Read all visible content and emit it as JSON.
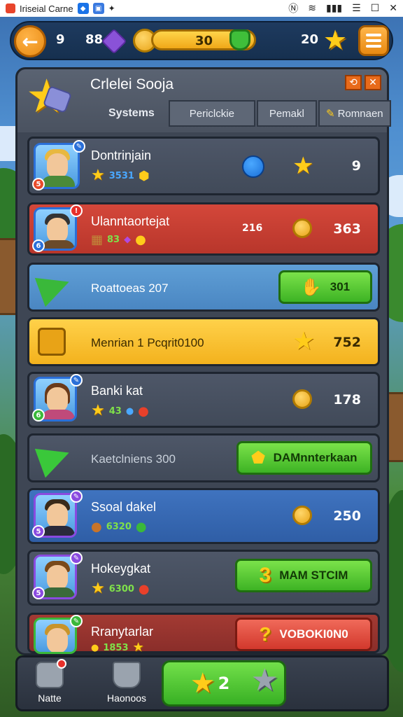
{
  "status_bar": {
    "app_title": "Iriseial Carne",
    "icons": [
      "app-icon",
      "shield-app-icon",
      "photo-icon",
      "settings-icon"
    ],
    "right_icons": [
      "nfc-icon",
      "wifi-icon",
      "signal-icon",
      "menu-icon",
      "window-icon",
      "close-icon"
    ]
  },
  "hud": {
    "level": "9",
    "gems": "88",
    "xp": "30",
    "xp_fill_percent": 100,
    "stars": "20"
  },
  "panel": {
    "title": "Crlelei Sooja",
    "tabs": [
      {
        "label": "Systems",
        "active": true
      },
      {
        "label": "Periclckie",
        "active": false
      },
      {
        "label": "Pemakl",
        "active": false
      },
      {
        "label": "Romnaen",
        "active": false
      }
    ],
    "close_symbol": "✕",
    "help_symbol": "⟲"
  },
  "rows": [
    {
      "name": "Dontrinjain",
      "sub": "3531",
      "value": "9",
      "style": "gray"
    },
    {
      "name": "Ulanntaortejat",
      "sub": "83",
      "value_prefix": "216",
      "value": "363",
      "style": "red"
    },
    {
      "text": "Roattoeas 207",
      "button": "301",
      "style": "blue"
    },
    {
      "text": "Menrian 1 Pcqrit0100",
      "value": "752",
      "style": "yellow"
    },
    {
      "name": "Banki kat",
      "sub": "43",
      "value": "178",
      "style": "gray"
    },
    {
      "text": "Kaetclniens 300",
      "button": "DAMnnterkaan",
      "style": "gray"
    },
    {
      "name": "Ssoal dakel",
      "sub": "6320",
      "value": "250",
      "style": "darkblue"
    },
    {
      "name": "Hokeygkat",
      "sub": "6300",
      "button": "MAM STCIM",
      "button_prefix": "3",
      "style": "gray"
    },
    {
      "name": "Rranytarlar",
      "sub": "1853",
      "button": "VOBOKI0N0",
      "button_prefix": "?",
      "style": "darkred"
    }
  ],
  "bottom_nav": {
    "items": [
      {
        "label": "Natte"
      },
      {
        "label": "Haonoos"
      }
    ],
    "main_button": "2"
  },
  "colors": {
    "accent_orange": "#e88a12",
    "green": "#3db324",
    "red": "#d2382c",
    "yellow": "#f3b21d",
    "blue": "#4a86c2"
  }
}
